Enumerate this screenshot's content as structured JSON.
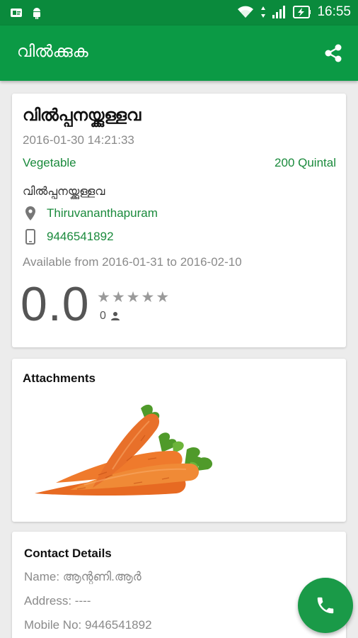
{
  "status_bar": {
    "time": "16:55"
  },
  "app_bar": {
    "title": "വിൽക്കുക",
    "share_icon": "share-icon"
  },
  "listing": {
    "title": "വിൽപ്പനയ്ക്കുള്ളവ",
    "datetime": "2016-01-30 14:21:33",
    "category": "Vegetable",
    "quantity": "200 Quintal",
    "seller_label": "വിൽപ്പനയ്ക്കുള്ളവ",
    "location": "Thiruvananthapuram",
    "phone": "9446541892",
    "availability": "Available from 2016-01-31 to 2016-02-10",
    "rating": "0.0",
    "stars": [
      "★",
      "★",
      "★",
      "★",
      "★"
    ],
    "rating_count": "0"
  },
  "attachments": {
    "title": "Attachments"
  },
  "contact": {
    "title": "Contact Details",
    "name": "Name: ആന്റണി.ആർ",
    "address": "Address: ----",
    "mobile": "Mobile No: 9446541892"
  },
  "colors": {
    "primary": "#0b9a45",
    "status_bar": "#0a8a3c",
    "accent_text": "#1a8a3c",
    "fab": "#1a9a48"
  }
}
